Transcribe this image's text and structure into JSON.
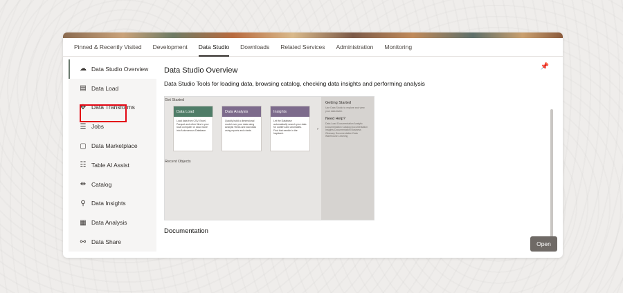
{
  "tabs": [
    "Pinned & Recently Visited",
    "Development",
    "Data Studio",
    "Downloads",
    "Related Services",
    "Administration",
    "Monitoring"
  ],
  "active_tab": "Data Studio",
  "sidebar": {
    "items": [
      {
        "label": "Data Studio Overview",
        "icon": "cloud-icon"
      },
      {
        "label": "Data Load",
        "icon": "data-load-icon"
      },
      {
        "label": "Data Transforms",
        "icon": "move-icon"
      },
      {
        "label": "Jobs",
        "icon": "jobs-list-icon"
      },
      {
        "label": "Data Marketplace",
        "icon": "bag-icon"
      },
      {
        "label": "Table AI Assist",
        "icon": "table-ai-icon"
      },
      {
        "label": "Catalog",
        "icon": "catalog-icon"
      },
      {
        "label": "Data Insights",
        "icon": "insights-icon"
      },
      {
        "label": "Data Analysis",
        "icon": "analysis-icon"
      },
      {
        "label": "Data Share",
        "icon": "share-icon"
      }
    ]
  },
  "main": {
    "title": "Data Studio Overview",
    "subtitle": "Data Studio Tools for loading data, browsing catalog, checking data insights and performing analysis",
    "documentation": "Documentation",
    "open_button": "Open",
    "pin_icon": "pin-icon"
  },
  "preview": {
    "get_started": "Get Started",
    "recent_objects": "Recent Objects",
    "cards": [
      {
        "title": "Data Load",
        "color": "#4f7d68",
        "text": "Load data from CSV, Excel, Parquet and other files in your local computer or cloud store into Autonomous Database."
      },
      {
        "title": "Data Analysis",
        "color": "#7d6b8c",
        "text": "Quickly build a dimensional model over your data using Analytic Views and load data using reports and charts."
      },
      {
        "title": "Insights",
        "color": "#7d6b8c",
        "text": "Let the Database automatically search your data for outliers and anomalies. Find that needle in the haystack."
      }
    ],
    "side": {
      "head1": "Getting Started",
      "text1": "Use Data Studio to explore and view your data faster.",
      "head2": "Need Help?",
      "text2": "Data Load Documentation Analytic Documentation Catalog Documentation Insights Documentation Business Glossary Documentation Data Warehouse Learning"
    }
  },
  "colors": {
    "highlight": "#e30613",
    "button": "#6f6a66"
  }
}
